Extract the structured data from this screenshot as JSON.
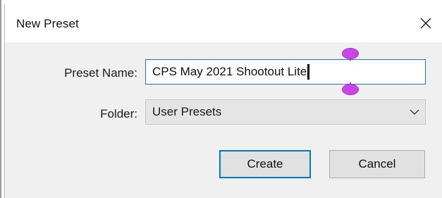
{
  "dialog": {
    "title": "New Preset",
    "close_icon": "close-icon"
  },
  "form": {
    "preset_name_label": "Preset Name:",
    "preset_name_value": "CPS May 2021 Shootout Lite",
    "folder_label": "Folder:",
    "folder_value": "User Presets",
    "folder_dropdown_icon": "chevron-down-icon"
  },
  "buttons": {
    "create_label": "Create",
    "cancel_label": "Cancel"
  },
  "colors": {
    "focus_accent": "#0078d7",
    "selection_handle": "#cc44e8",
    "dialog_body": "#f0f0f0"
  }
}
